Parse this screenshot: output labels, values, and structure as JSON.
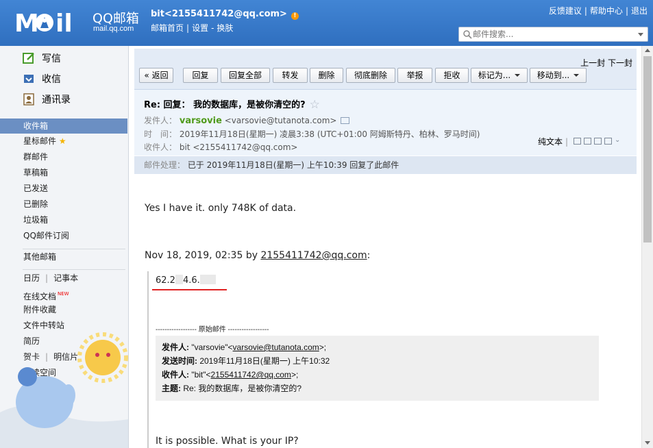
{
  "header": {
    "logo_cn": "QQ邮箱",
    "logo_url": "mail.qq.com",
    "user": "bit<2155411742@qq.com>",
    "warn": "!",
    "links": [
      "邮箱首页",
      "设置",
      "换肤"
    ],
    "top_links": [
      "反馈建议",
      "帮助中心",
      "退出"
    ],
    "search_placeholder": "邮件搜索...",
    "colors": {
      "header_bg": "#3a7bc8"
    }
  },
  "sidebar": {
    "write": "写信",
    "inbox": "收信",
    "contacts": "通讯录",
    "folders": {
      "inbox": "收件箱",
      "starred": "星标邮件",
      "starred_icon": "★",
      "group": "群邮件",
      "drafts": "草稿箱",
      "sent": "已发送",
      "deleted": "已删除",
      "spam": "垃圾箱",
      "subscriptions": "QQ邮件订阅",
      "other": "其他邮箱",
      "calendar": "日历",
      "notes": "记事本",
      "docs": "在线文档",
      "docs_new": "NEW",
      "attachments": "附件收藏",
      "transfer": "文件中转站",
      "resume": "简历",
      "cards": "贺卡",
      "postcards": "明信片",
      "reading": "阅读空间"
    }
  },
  "toolbar": {
    "prev": "上一封",
    "next": "下一封",
    "back": "« 返回",
    "reply": "回复",
    "reply_all": "回复全部",
    "forward": "转发",
    "delete": "删除",
    "delete_perm": "彻底删除",
    "report": "举报",
    "reject": "拒收",
    "mark_as": "标记为...",
    "move_to": "移动到..."
  },
  "mail": {
    "subject": "Re: 回复： 我的数据库，是被你清空的?",
    "fav_icon": "☆",
    "from_label": "发件人：",
    "from_name": "varsovie",
    "from_addr": "<varsovie@tutanota.com>",
    "time_label": "时　间：",
    "time_value": "2019年11月18日(星期一) 凌晨3:38 (UTC+01:00 阿姆斯特丹、柏林、罗马时间)",
    "to_label": "收件人：",
    "to_value": "bit <2155411742@qq.com>",
    "plaintext": "纯文本",
    "process_label": "邮件处理：",
    "process_value": "已于 2019年11月18日(星期一) 上午10:39 回复了此邮件"
  },
  "body": {
    "line1": "Yes I have it. only 748K of data.",
    "line2_prefix": "Nov 18, 2019, 02:35 by ",
    "line2_link": "2155411742@qq.com",
    "line2_suffix": ":",
    "ip_a": "62.2",
    "ip_b": "4.6.",
    "orig_header": "------------------ 原始邮件 ------------------",
    "orig": {
      "from_label": "发件人:",
      "from_value_pre": " \"varsovie\"<",
      "from_link": "varsovie@tutanota.com",
      "from_value_post": ">;",
      "time_label": "发送时间:",
      "time_value": " 2019年11月18日(星期一) 上午10:32",
      "to_label": "收件人:",
      "to_value_pre": " \"bit\"<",
      "to_link": "2155411742@qq.com",
      "to_value_post": ">;",
      "subject_label": "主题:",
      "subject_value": " Re: 我的数据库，是被你清空的?"
    },
    "line3": "It is possible. What is your IP?"
  }
}
